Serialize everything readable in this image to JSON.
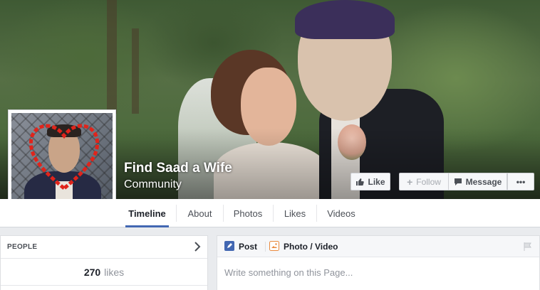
{
  "page": {
    "name": "Find Saad a Wife",
    "category": "Community"
  },
  "cover_actions": {
    "like_label": "Like",
    "follow_label": "Follow",
    "message_label": "Message",
    "more_label": "•••"
  },
  "nav": {
    "tabs": [
      {
        "label": "Timeline",
        "active": true
      },
      {
        "label": "About",
        "active": false
      },
      {
        "label": "Photos",
        "active": false
      },
      {
        "label": "Likes",
        "active": false
      },
      {
        "label": "Videos",
        "active": false
      }
    ]
  },
  "people": {
    "title": "PEOPLE",
    "likes_count": "270",
    "likes_label": "likes"
  },
  "composer": {
    "post_label": "Post",
    "photo_video_label": "Photo / Video",
    "placeholder": "Write something on this Page..."
  },
  "colors": {
    "accent": "#4267b2",
    "heart": "#e0241b"
  },
  "icons": {
    "like": "thumbs-up-icon",
    "follow": "plus-icon",
    "message": "speech-bubble-icon",
    "more": "ellipsis-icon",
    "chevron": "chevron-right-icon",
    "post": "pencil-icon",
    "photo": "photo-icon",
    "flag": "flag-icon"
  }
}
